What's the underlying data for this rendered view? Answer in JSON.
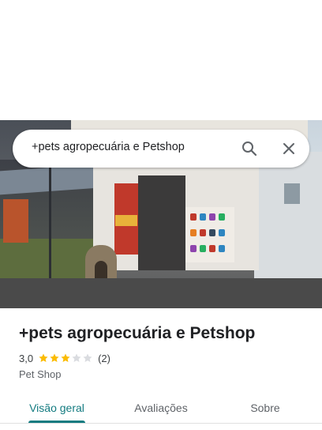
{
  "search": {
    "query": "+pets agropecuária e Petshop",
    "search_icon": "search-icon",
    "close_icon": "close-icon"
  },
  "place": {
    "name": "+pets agropecuária e Petshop",
    "rating": "3,0",
    "rating_value": 3.0,
    "stars_filled": 3,
    "stars_total": 5,
    "review_count": "(2)",
    "category": "Pet Shop"
  },
  "tabs": [
    {
      "label": "Visão geral",
      "active": true
    },
    {
      "label": "Avaliações",
      "active": false
    },
    {
      "label": "Sobre",
      "active": false
    }
  ],
  "colors": {
    "accent": "#137b80",
    "star_filled": "#fbbc04",
    "star_empty": "#dadce0"
  }
}
